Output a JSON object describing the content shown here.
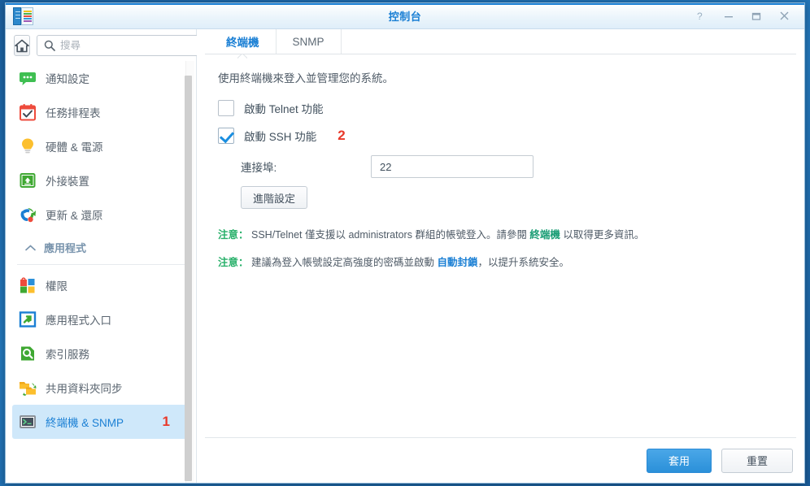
{
  "window": {
    "title": "控制台",
    "app_icon": "control-panel-icon",
    "controls": [
      {
        "name": "help-button",
        "glyph": "?"
      },
      {
        "name": "minimize-button",
        "glyph": "—"
      },
      {
        "name": "maximize-button",
        "glyph": "▭"
      },
      {
        "name": "close-button",
        "glyph": "✕"
      }
    ]
  },
  "sidebar": {
    "home_icon": "home-icon",
    "search": {
      "placeholder": "搜尋",
      "value": ""
    },
    "items": [
      {
        "label": "通知設定",
        "icon": "notification-icon",
        "selected": false,
        "badge": ""
      },
      {
        "label": "任務排程表",
        "icon": "task-scheduler-icon",
        "selected": false,
        "badge": ""
      },
      {
        "label": "硬體 & 電源",
        "icon": "hardware-power-icon",
        "selected": false,
        "badge": ""
      },
      {
        "label": "外接裝置",
        "icon": "external-device-icon",
        "selected": false,
        "badge": ""
      },
      {
        "label": "更新 & 還原",
        "icon": "update-restore-icon",
        "selected": false,
        "badge": ""
      }
    ],
    "section": {
      "label": "應用程式",
      "chevron": "chevron-up-icon"
    },
    "app_items": [
      {
        "label": "權限",
        "icon": "privileges-icon",
        "selected": false,
        "badge": ""
      },
      {
        "label": "應用程式入口",
        "icon": "app-portal-icon",
        "selected": false,
        "badge": ""
      },
      {
        "label": "索引服務",
        "icon": "indexing-service-icon",
        "selected": false,
        "badge": ""
      },
      {
        "label": "共用資料夾同步",
        "icon": "shared-folder-sync-icon",
        "selected": false,
        "badge": ""
      },
      {
        "label": "終端機 & SNMP",
        "icon": "terminal-snmp-icon",
        "selected": true,
        "badge": "1"
      }
    ]
  },
  "main": {
    "tabs": [
      {
        "label": "終端機",
        "active": true
      },
      {
        "label": "SNMP",
        "active": false
      }
    ],
    "intro": "使用終端機來登入並管理您的系統。",
    "telnet": {
      "label": "啟動 Telnet 功能",
      "checked": false,
      "badge": ""
    },
    "ssh": {
      "label": "啟動 SSH 功能",
      "checked": true,
      "badge": "2"
    },
    "port": {
      "label": "連接埠:",
      "value": "22"
    },
    "advanced_button": "進階設定",
    "notes": [
      {
        "tag": "注意：",
        "text_before": "SSH/Telnet 僅支援以 administrators 群組的帳號登入。請參閱 ",
        "link": "終端機",
        "link_style": "green",
        "text_after": " 以取得更多資訊。"
      },
      {
        "tag": "注意：",
        "text_before": "建議為登入帳號設定高強度的密碼並啟動 ",
        "link": "自動封鎖",
        "link_style": "blue",
        "text_after": "，以提升系統安全。"
      }
    ]
  },
  "footer": {
    "apply_label": "套用",
    "reset_label": "重置"
  },
  "colors": {
    "accent": "#1a7fd4",
    "badge_red": "#e8392a",
    "note_green": "#28b06a",
    "selected_bg": "#cfe8fa"
  }
}
